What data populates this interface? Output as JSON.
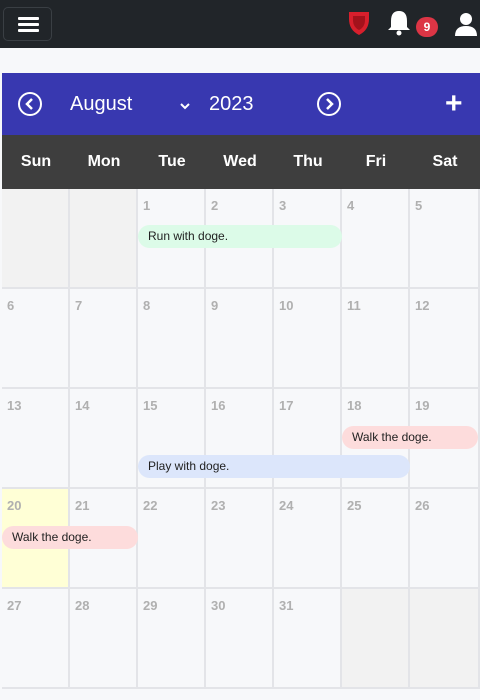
{
  "topbar": {
    "notification_count": "9",
    "icons": [
      "menu-icon",
      "shield-icon",
      "bell-icon",
      "user-icon"
    ]
  },
  "calendar": {
    "month": "August",
    "year": "2023",
    "add_label": "+",
    "weekdays": [
      "Sun",
      "Mon",
      "Tue",
      "Wed",
      "Thu",
      "Fri",
      "Sat"
    ],
    "days": [
      [
        "",
        "",
        "1",
        "2",
        "3",
        "4",
        "5"
      ],
      [
        "6",
        "7",
        "8",
        "9",
        "10",
        "11",
        "12"
      ],
      [
        "13",
        "14",
        "15",
        "16",
        "17",
        "18",
        "19"
      ],
      [
        "20",
        "21",
        "22",
        "23",
        "24",
        "25",
        "26"
      ],
      [
        "27",
        "28",
        "29",
        "30",
        "31",
        "",
        ""
      ]
    ],
    "today": "20",
    "events": [
      {
        "title": "Run with doge.",
        "color": "#dcfbe8"
      },
      {
        "title": "Walk the doge.",
        "color": "#fddcdc"
      },
      {
        "title": "Play with doge.",
        "color": "#dce6fb"
      },
      {
        "title": "Walk the doge.",
        "color": "#fddcdc"
      }
    ]
  },
  "colors": {
    "topbar": "#212529",
    "header": "#3838b0",
    "weekday_bar": "#3e3e3e",
    "badge": "#dc3545",
    "shield": "#d81f2c",
    "today": "#ffffd6"
  }
}
